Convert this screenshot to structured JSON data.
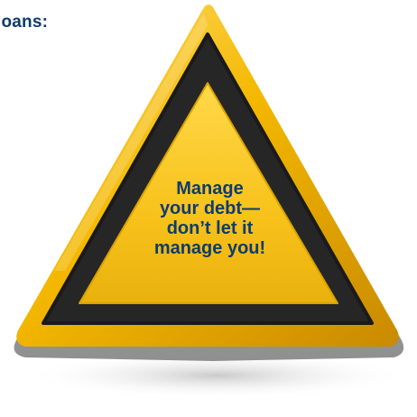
{
  "heading": {
    "text": "loans:"
  },
  "sign": {
    "icon": "warning-triangle-icon",
    "lines": [
      "Manage",
      "your debt—",
      "don’t let it",
      "manage you!"
    ]
  },
  "colors": {
    "text": "#0d3c6e",
    "sign_yellow": "#f7c21a",
    "sign_border_dark": "#2b2b2b",
    "sign_rim": "#f2b500"
  }
}
